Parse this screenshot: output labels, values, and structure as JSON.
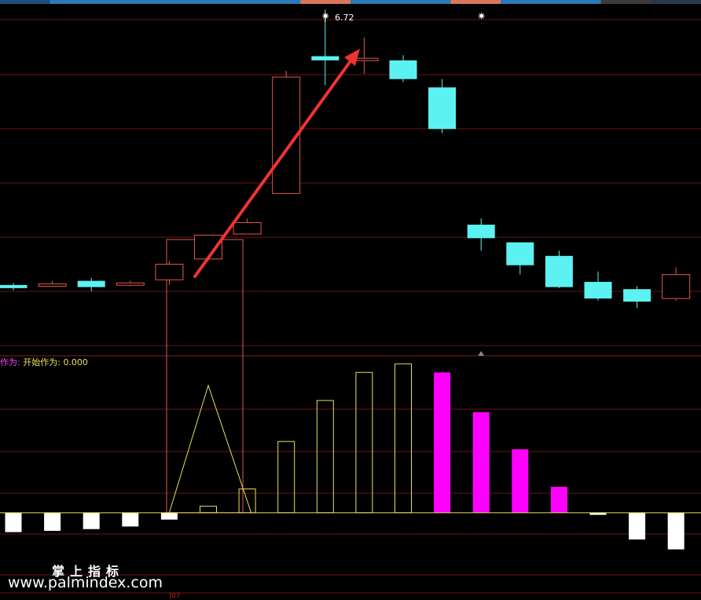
{
  "colors": {
    "background": "#000000",
    "up": "#e05a4a",
    "down": "#5cf2f2",
    "grid": "#6b1414",
    "yellow": "#e8e05a",
    "magenta": "#ff00ff",
    "white": "#ffffff",
    "arrow": "#ee3333"
  },
  "top_tabs": [
    {
      "color": "#1f4f7a"
    },
    {
      "color": "#2b7ab8"
    },
    {
      "color": "#2b7ab8"
    },
    {
      "color": "#2b7ab8"
    },
    {
      "color": "#2b7ab8"
    },
    {
      "color": "#2b7ab8"
    },
    {
      "color": "#d9775a"
    },
    {
      "color": "#2b7ab8"
    },
    {
      "color": "#2b7ab8"
    },
    {
      "color": "#d9775a"
    },
    {
      "color": "#2b7ab8"
    },
    {
      "color": "#2b7ab8"
    },
    {
      "color": "#3b3b3b"
    },
    {
      "color": "#2a3a4a"
    }
  ],
  "high_marker": {
    "label": "6.72"
  },
  "indicator_legend": {
    "prefix": "作为:",
    "name": "开始作为:",
    "value": "0.000"
  },
  "bottom_tick": "|07",
  "watermark": {
    "cn": "掌上指标",
    "url": "www.palmindex.com"
  },
  "chart_data": [
    {
      "type": "candlestick",
      "title": "",
      "price_high_label": 6.72,
      "candles": [
        {
          "open": 4.07,
          "close": 4.04,
          "high": 4.09,
          "low": 4.02,
          "dir": "down"
        },
        {
          "open": 4.06,
          "close": 4.08,
          "high": 4.11,
          "low": 4.06,
          "dir": "up"
        },
        {
          "open": 4.11,
          "close": 4.05,
          "high": 4.14,
          "low": 4.01,
          "dir": "down"
        },
        {
          "open": 4.08,
          "close": 4.09,
          "high": 4.11,
          "low": 4.06,
          "dir": "up"
        },
        {
          "open": 4.12,
          "close": 4.27,
          "high": 4.3,
          "low": 4.07,
          "dir": "up"
        },
        {
          "open": 4.32,
          "close": 4.55,
          "high": 4.55,
          "low": 4.3,
          "dir": "up"
        },
        {
          "open": 4.56,
          "close": 4.67,
          "high": 4.71,
          "low": 4.56,
          "dir": "up"
        },
        {
          "open": 4.95,
          "close": 6.07,
          "high": 6.13,
          "low": 4.95,
          "dir": "up"
        },
        {
          "open": 6.27,
          "close": 6.23,
          "high": 6.72,
          "low": 5.99,
          "dir": "down"
        },
        {
          "open": 6.24,
          "close": 6.25,
          "high": 6.45,
          "low": 6.1,
          "dir": "up"
        },
        {
          "open": 6.23,
          "close": 6.05,
          "high": 6.28,
          "low": 6.02,
          "dir": "down"
        },
        {
          "open": 5.97,
          "close": 5.57,
          "high": 6.05,
          "low": 5.53,
          "dir": "down"
        },
        {
          "open": 4.65,
          "close": 4.52,
          "high": 4.71,
          "low": 4.4,
          "dir": "down"
        },
        {
          "open": 4.48,
          "close": 4.26,
          "high": 4.48,
          "low": 4.17,
          "dir": "down"
        },
        {
          "open": 4.35,
          "close": 4.05,
          "high": 4.4,
          "low": 4.04,
          "dir": "down"
        },
        {
          "open": 4.1,
          "close": 3.94,
          "high": 4.2,
          "low": 3.92,
          "dir": "down"
        },
        {
          "open": 4.03,
          "close": 3.91,
          "high": 4.06,
          "low": 3.85,
          "dir": "down"
        },
        {
          "open": 3.94,
          "close": 4.17,
          "high": 4.24,
          "low": 3.92,
          "dir": "up"
        }
      ],
      "ylim": [
        3.45,
        6.75
      ],
      "grid": true
    },
    {
      "type": "bar",
      "title": "",
      "values": [
        -0.45,
        -0.42,
        -0.38,
        -0.32,
        -0.16,
        0.15,
        0.55,
        1.65,
        2.6,
        3.25,
        3.45,
        3.25,
        2.33,
        1.47,
        0.6,
        -0.05,
        -0.62,
        -0.85
      ],
      "styles": [
        "white",
        "white",
        "white",
        "white",
        "white",
        "yellow",
        "yellow",
        "yellow",
        "yellow",
        "yellow",
        "yellow",
        "magenta",
        "magenta",
        "magenta",
        "magenta",
        "white",
        "white",
        "white"
      ],
      "triangle_peak": 2.95,
      "ylim": [
        -1.95,
        3.6
      ],
      "grid": true
    }
  ]
}
